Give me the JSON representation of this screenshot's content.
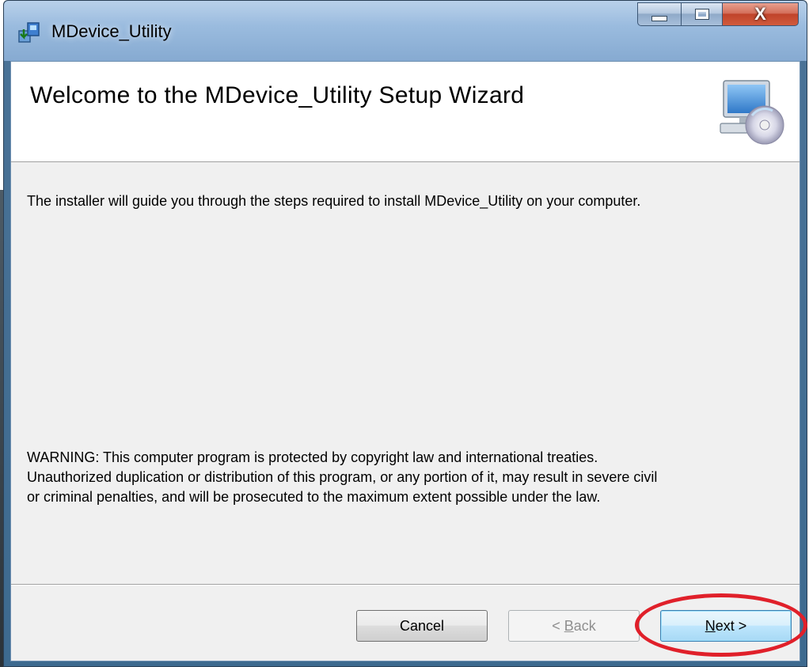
{
  "window": {
    "title": "MDevice_Utility",
    "close_glyph": "X"
  },
  "header": {
    "title": "Welcome to the MDevice_Utility Setup Wizard",
    "icon": "computer-with-cd-icon"
  },
  "body": {
    "intro": "The installer will guide you through the steps required to install MDevice_Utility on your computer.",
    "warning_lines": [
      "WARNING: This computer program is protected by copyright law and international treaties.",
      "Unauthorized duplication or distribution of this program, or any portion of it, may result in severe civil",
      "or criminal penalties, and will be prosecuted to the maximum extent possible under the law."
    ]
  },
  "buttons": {
    "cancel": "Cancel",
    "back_prefix": "< ",
    "back_key": "B",
    "back_rest": "ack",
    "next_key": "N",
    "next_rest": "ext >"
  },
  "colors": {
    "highlight": "#e0202a",
    "dialog_bg": "#f0f0f0",
    "titlebar": "#9bbcdf"
  }
}
